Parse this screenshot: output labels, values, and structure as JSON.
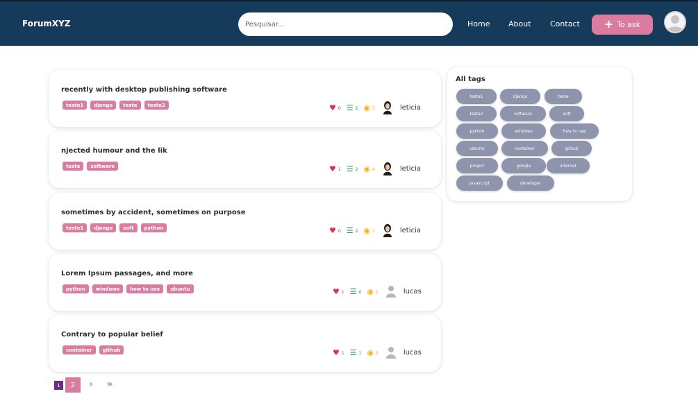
{
  "header": {
    "brand": "ForumXYZ",
    "search_placeholder": "Pesquisar...",
    "nav": [
      "Home",
      "About",
      "Contact"
    ],
    "ask_label": "To ask",
    "ask_icon": "plus-icon"
  },
  "questions": [
    {
      "title": "recently with desktop publishing software",
      "tags": [
        "teste1",
        "django",
        "teste",
        "teste2"
      ],
      "likes": "0",
      "answers": "2",
      "views": "5",
      "user": "leticia"
    },
    {
      "title": "njected humour and the lik",
      "tags": [
        "teste",
        "software"
      ],
      "likes": "1",
      "answers": "2",
      "views": "4",
      "user": "leticia"
    },
    {
      "title": "sometimes by accident, sometimes on purpose",
      "tags": [
        "teste1",
        "django",
        "soft",
        "python"
      ],
      "likes": "0",
      "answers": "2",
      "views": "1",
      "user": "leticia"
    },
    {
      "title": "Lorem Ipsum passages, and more",
      "tags": [
        "python",
        "windows",
        "how to use",
        "ubuntu"
      ],
      "likes": "1",
      "answers": "0",
      "views": "2",
      "user": "lucas"
    },
    {
      "title": "Contrary to popular belief",
      "tags": [
        "container",
        "github"
      ],
      "likes": "1",
      "answers": "1",
      "views": "2",
      "user": "lucas"
    }
  ],
  "sidebar": {
    "title": "All tags",
    "tags": [
      "teste1",
      "django",
      "teste",
      "teste2",
      "software",
      "soft",
      "python",
      "windows",
      "how to use",
      "ubuntu",
      "container",
      "github",
      "project",
      "google",
      "internet",
      "javascript",
      "developer"
    ]
  },
  "pagination": {
    "current": "1",
    "next_page": "2",
    "next_icon": "chevron-right-icon",
    "last_icon": "double-chevron-right-icon"
  },
  "colors": {
    "navbar": "#163a5a",
    "accent_pink": "#d97ca0",
    "tag_gray": "#8d94ab",
    "heart": "#d8344a",
    "answers_green": "#1f8a52",
    "views_yellow": "#f2b218",
    "page_active": "#6b2f7a"
  }
}
